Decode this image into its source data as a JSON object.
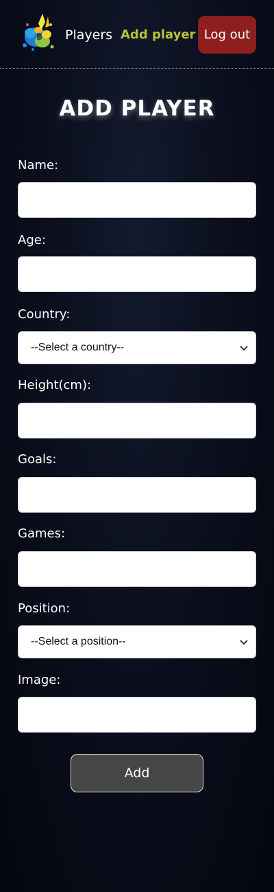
{
  "nav": {
    "players_label": "Players",
    "add_player_label": "Add player",
    "logout_label": "Log out",
    "active_color": "#b9c23a",
    "logout_color": "#8e1f1f"
  },
  "logo": {
    "icon": "paint-splash-logo-icon"
  },
  "form": {
    "title": "ADD PLAYER",
    "fields": {
      "name": {
        "label": "Name:",
        "value": ""
      },
      "age": {
        "label": "Age:",
        "value": ""
      },
      "country": {
        "label": "Country:",
        "selected": "--Select a country--"
      },
      "height": {
        "label": "Height(cm):",
        "value": ""
      },
      "goals": {
        "label": "Goals:",
        "value": ""
      },
      "games": {
        "label": "Games:",
        "value": ""
      },
      "position": {
        "label": "Position:",
        "selected": "--Select a position--"
      },
      "image": {
        "label": "Image:",
        "value": ""
      }
    },
    "submit_label": "Add"
  }
}
